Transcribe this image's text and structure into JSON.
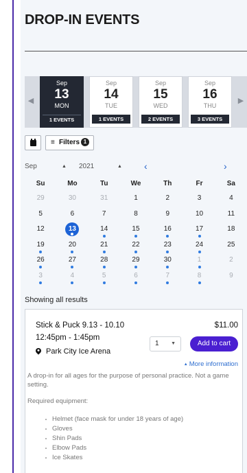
{
  "page": {
    "title": "DROP-IN EVENTS"
  },
  "carousel": {
    "days": [
      {
        "month": "Sep",
        "day": "13",
        "weekday": "MON",
        "events": "1 EVENTS",
        "active": true
      },
      {
        "month": "Sep",
        "day": "14",
        "weekday": "TUE",
        "events": "1 EVENTS",
        "active": false
      },
      {
        "month": "Sep",
        "day": "15",
        "weekday": "WED",
        "events": "2 EVENTS",
        "active": false
      },
      {
        "month": "Sep",
        "day": "16",
        "weekday": "THU",
        "events": "3 EVENTS",
        "active": false
      }
    ]
  },
  "toolbar": {
    "filters_label": "Filters",
    "filters_count": "1"
  },
  "calendar": {
    "month": "Sep",
    "year": "2021",
    "weekdays": [
      "Su",
      "Mo",
      "Tu",
      "We",
      "Th",
      "Fr",
      "Sa"
    ],
    "weeks": [
      [
        {
          "d": "29",
          "m": true,
          "dot": false
        },
        {
          "d": "30",
          "m": true,
          "dot": false
        },
        {
          "d": "31",
          "m": true,
          "dot": false
        },
        {
          "d": "1",
          "m": false,
          "dot": false
        },
        {
          "d": "2",
          "m": false,
          "dot": false
        },
        {
          "d": "3",
          "m": false,
          "dot": false
        },
        {
          "d": "4",
          "m": false,
          "dot": false
        }
      ],
      [
        {
          "d": "5",
          "m": false,
          "dot": false
        },
        {
          "d": "6",
          "m": false,
          "dot": false
        },
        {
          "d": "7",
          "m": false,
          "dot": false
        },
        {
          "d": "8",
          "m": false,
          "dot": false
        },
        {
          "d": "9",
          "m": false,
          "dot": false
        },
        {
          "d": "10",
          "m": false,
          "dot": false
        },
        {
          "d": "11",
          "m": false,
          "dot": false
        }
      ],
      [
        {
          "d": "12",
          "m": false,
          "dot": false
        },
        {
          "d": "13",
          "m": false,
          "dot": true,
          "today": true
        },
        {
          "d": "14",
          "m": false,
          "dot": true
        },
        {
          "d": "15",
          "m": false,
          "dot": true
        },
        {
          "d": "16",
          "m": false,
          "dot": true
        },
        {
          "d": "17",
          "m": false,
          "dot": true
        },
        {
          "d": "18",
          "m": false,
          "dot": false
        }
      ],
      [
        {
          "d": "19",
          "m": false,
          "dot": true
        },
        {
          "d": "20",
          "m": false,
          "dot": true
        },
        {
          "d": "21",
          "m": false,
          "dot": true
        },
        {
          "d": "22",
          "m": false,
          "dot": true
        },
        {
          "d": "23",
          "m": false,
          "dot": true
        },
        {
          "d": "24",
          "m": false,
          "dot": true
        },
        {
          "d": "25",
          "m": false,
          "dot": false
        }
      ],
      [
        {
          "d": "26",
          "m": false,
          "dot": true
        },
        {
          "d": "27",
          "m": false,
          "dot": true
        },
        {
          "d": "28",
          "m": false,
          "dot": true
        },
        {
          "d": "29",
          "m": false,
          "dot": true
        },
        {
          "d": "30",
          "m": false,
          "dot": true
        },
        {
          "d": "1",
          "m": true,
          "dot": true
        },
        {
          "d": "2",
          "m": true,
          "dot": false
        }
      ],
      [
        {
          "d": "3",
          "m": true,
          "dot": true
        },
        {
          "d": "4",
          "m": true,
          "dot": true
        },
        {
          "d": "5",
          "m": true,
          "dot": true
        },
        {
          "d": "6",
          "m": true,
          "dot": true
        },
        {
          "d": "7",
          "m": true,
          "dot": true
        },
        {
          "d": "8",
          "m": true,
          "dot": true
        },
        {
          "d": "9",
          "m": true,
          "dot": false
        }
      ]
    ]
  },
  "results": {
    "showing": "Showing all results"
  },
  "event": {
    "title": "Stick & Puck 9.13 - 10.10",
    "price": "$11.00",
    "time": "12:45pm - 1:45pm",
    "location": "Park City Ice Arena",
    "quantity": "1",
    "add_to_cart": "Add to cart",
    "more_info": "More information",
    "description": "A drop-in for all ages for the purpose of personal practice. Not a game setting.",
    "required_label": "Required equipment:",
    "equipment": [
      "Helmet (face mask for under 18 years of age)",
      "Gloves",
      "Shin Pads",
      "Elbow Pads",
      "Ice Skates"
    ]
  },
  "colors": {
    "accent": "#4a1fd1",
    "link": "#2563c9",
    "dark": "#232833",
    "today": "#1d63d6"
  }
}
